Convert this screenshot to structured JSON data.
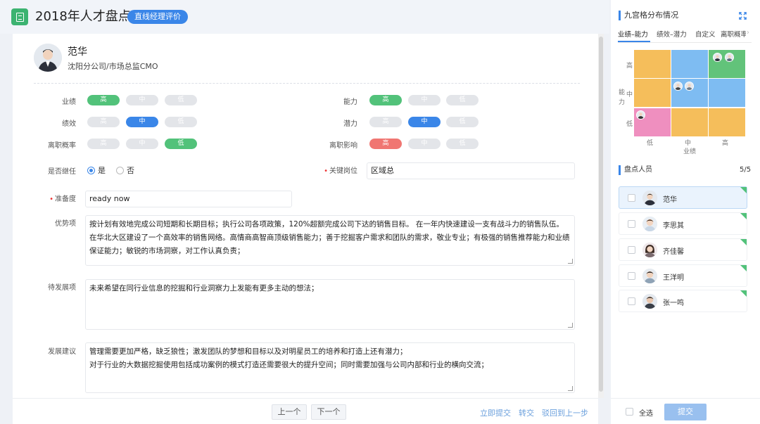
{
  "header": {
    "title": "2018年人才盘点",
    "badge": "直线经理评价"
  },
  "employee": {
    "name": "范华",
    "dept": "沈阳分公司/市场总监CMO"
  },
  "ratings": {
    "performance": {
      "label": "业绩",
      "options": [
        "高",
        "中",
        "低"
      ],
      "selected": "高",
      "color": "#52c27a"
    },
    "ability": {
      "label": "能力",
      "options": [
        "高",
        "中",
        "低"
      ],
      "selected": "高",
      "color": "#52c27a"
    },
    "effectiveness": {
      "label": "绩效",
      "options": [
        "高",
        "中",
        "低"
      ],
      "selected": "中",
      "color": "#3a86e8"
    },
    "potential": {
      "label": "潜力",
      "options": [
        "高",
        "中",
        "低"
      ],
      "selected": "中",
      "color": "#3a86e8"
    },
    "turnover": {
      "label": "离职概率",
      "options": [
        "高",
        "中",
        "低"
      ],
      "selected": "低",
      "color": "#52c27a"
    },
    "impact": {
      "label": "离职影响",
      "options": [
        "高",
        "中",
        "低"
      ],
      "selected": "高",
      "color": "#f07672"
    }
  },
  "successor": {
    "label": "是否继任",
    "yes": "是",
    "no": "否",
    "selected": "是"
  },
  "key_position": {
    "label": "关键岗位",
    "value": "区域总"
  },
  "readiness": {
    "label": "准备度",
    "value": "ready now"
  },
  "strengths": {
    "label": "优势项",
    "text": "按计划有效地完成公司短期和长期目标；执行公司各项政策，120%超额完成公司下达的销售目标。 在一年内快速建设一支有战斗力的销售队伍。在华北大区建设了一个高效率的销售网络。高情商高智商顶级销售能力；善于挖掘客户需求和团队的需求，敬业专业；有极强的销售推荐能力和业绩保证能力；敏锐的市场洞察，对工作认真负责；"
  },
  "improvements": {
    "label": "待发展项",
    "text": "未来希望在同行业信息的挖掘和行业洞察力上发能有更多主动的想法；"
  },
  "suggestions": {
    "label": "发展建议",
    "line1": "管理需要更加严格，缺乏狼性；激发团队的梦想和目标以及对明星员工的培养和打造上还有潜力；",
    "line2": "对于行业的大数据挖掘使用包括成功案例的模式打造还需要很大的提升空间；同时需要加强与公司内部和行业的横向交流；"
  },
  "footer": {
    "prev": "上一个",
    "next": "下一个",
    "submit_now": "立即提交",
    "transfer": "转交",
    "reject": "驳回到上一步"
  },
  "grid_panel": {
    "title": "九宫格分布情况",
    "tabs": [
      "业绩–能力",
      "绩效–潜力",
      "自定义",
      "离职概率"
    ],
    "y_axis": [
      "高",
      "中",
      "低"
    ],
    "y_label": "能力",
    "x_axis": [
      "低",
      "中",
      "高"
    ],
    "x_label": "业绩",
    "colors": {
      "orange": "#f5be5b",
      "blue": "#7ebcf2",
      "green": "#62c37a",
      "pink": "#ef8fbf"
    }
  },
  "people": {
    "title": "盘点人员",
    "count": "5/5",
    "list": [
      {
        "name": "范华"
      },
      {
        "name": "李思其"
      },
      {
        "name": "齐佳馨"
      },
      {
        "name": "王洋明"
      },
      {
        "name": "张一鸣"
      }
    ]
  },
  "bottom": {
    "select_all": "全选",
    "submit": "提交"
  }
}
